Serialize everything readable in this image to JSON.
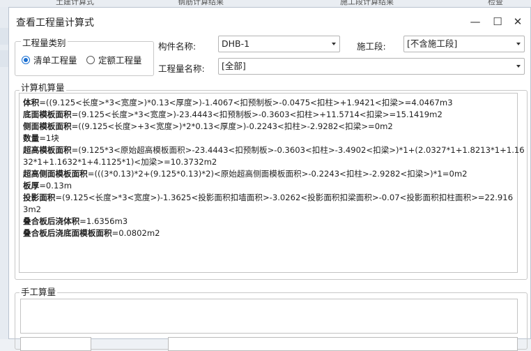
{
  "background": {
    "tabs": [
      "土建计算式",
      "钢筋计算结果",
      "施工段计算结果",
      "检查"
    ]
  },
  "dialog": {
    "title": "查看工程量计算式",
    "controls": {
      "minimize": "—",
      "maximize": "☐",
      "close": "✕"
    }
  },
  "category": {
    "legend": "工程量类别",
    "options": [
      "清单工程量",
      "定额工程量"
    ],
    "selected": 0
  },
  "filters": {
    "component_label": "构件名称:",
    "component_value": "DHB-1",
    "stage_label": "施工段:",
    "stage_value": "[不含施工段]",
    "quantity_label": "工程量名称:",
    "quantity_value": "[全部]"
  },
  "computed": {
    "legend": "计算机算量",
    "lines": [
      {
        "name": "体积",
        "text": "=((9.125<长度>*3<宽度>)*0.13<厚度>)-1.4067<扣预制板>-0.0475<扣柱>+1.9421<扣梁>=4.0467m3"
      },
      {
        "name": "底面模板面积",
        "text": "=(9.125<长度>*3<宽度>)-23.4443<扣预制板>-0.3603<扣柱>+11.5714<扣梁>=15.1419m2"
      },
      {
        "name": "侧面模板面积",
        "text": "=((9.125<长度>+3<宽度>)*2*0.13<厚度>)-0.2243<扣柱>-2.9282<扣梁>=0m2"
      },
      {
        "name": "数量",
        "text": "=1块"
      },
      {
        "name": "超高模板面积",
        "text": "=(9.125*3<原始超高模板面积>-23.4443<扣预制板>-0.3603<扣柱>-3.4902<扣梁>)*1+(2.0327*1+1.8213*1+1.16"
      },
      {
        "name": "",
        "text": "32*1+1.1632*1+4.1125*1)<加梁>=10.3732m2"
      },
      {
        "name": "超高侧面模板面积",
        "text": "=(((3*0.13)*2+(9.125*0.13)*2)<原始超高侧面模板面积>-0.2243<扣柱>-2.9282<扣梁>)*1=0m2"
      },
      {
        "name": "板厚",
        "text": "=0.13m"
      },
      {
        "name": "投影面积",
        "text": "=(9.125<长度>*3<宽度>)-1.3625<投影面积扣墙面积>-3.0262<投影面积扣梁面积>-0.07<投影面积扣柱面积>=22.916"
      },
      {
        "name": "",
        "text": "3m2"
      },
      {
        "name": "叠合板后浇体积",
        "text": "=1.6356m3"
      },
      {
        "name": "叠合板后浇底面模板面积",
        "text": "=0.0802m2"
      }
    ]
  },
  "manual": {
    "legend": "手工算量",
    "value": ""
  }
}
